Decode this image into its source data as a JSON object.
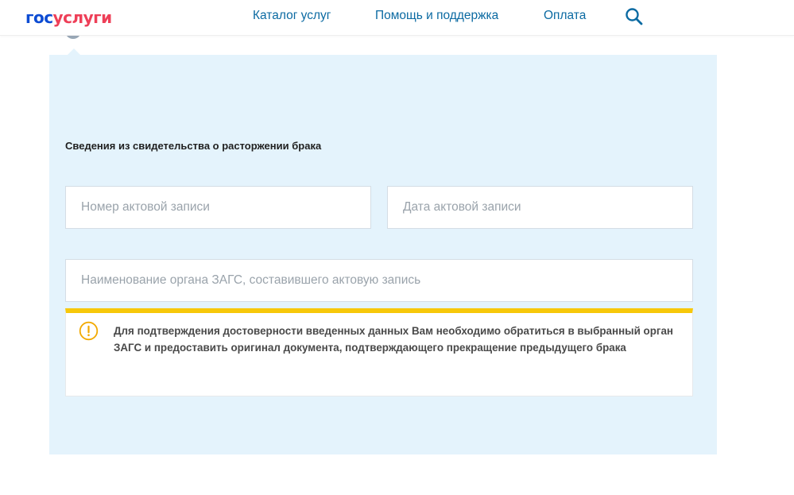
{
  "header": {
    "logo": {
      "part1": "гос",
      "part2": "услуги"
    },
    "nav": {
      "catalog": "Каталог услуг",
      "help": "Помощь и поддержка",
      "payment": "Оплата"
    },
    "icons": {
      "search": "search-icon"
    }
  },
  "form": {
    "section_title": "Сведения из свидетельства о расторжении брака",
    "fields": {
      "record_number_placeholder": "Номер актовой записи",
      "record_date_placeholder": "Дата актовой записи",
      "zags_name_placeholder": "Наименование органа ЗАГС, составившего актовую запись"
    },
    "warning": {
      "icon": "exclamation-circle-icon",
      "text": "Для подтверждения достоверности введенных данных Вам необходимо обратиться в выбранный орган ЗАГС и предоставить оригинал документа, подтверждающего прекращение предыдущего брака"
    }
  },
  "colors": {
    "logo_blue": "#0d4cd3",
    "logo_red": "#ee3f58",
    "nav_link": "#0b6aa2",
    "panel_bg": "#e4f3fc",
    "warning_accent": "#f7c80a",
    "placeholder": "#9aa3ab"
  }
}
